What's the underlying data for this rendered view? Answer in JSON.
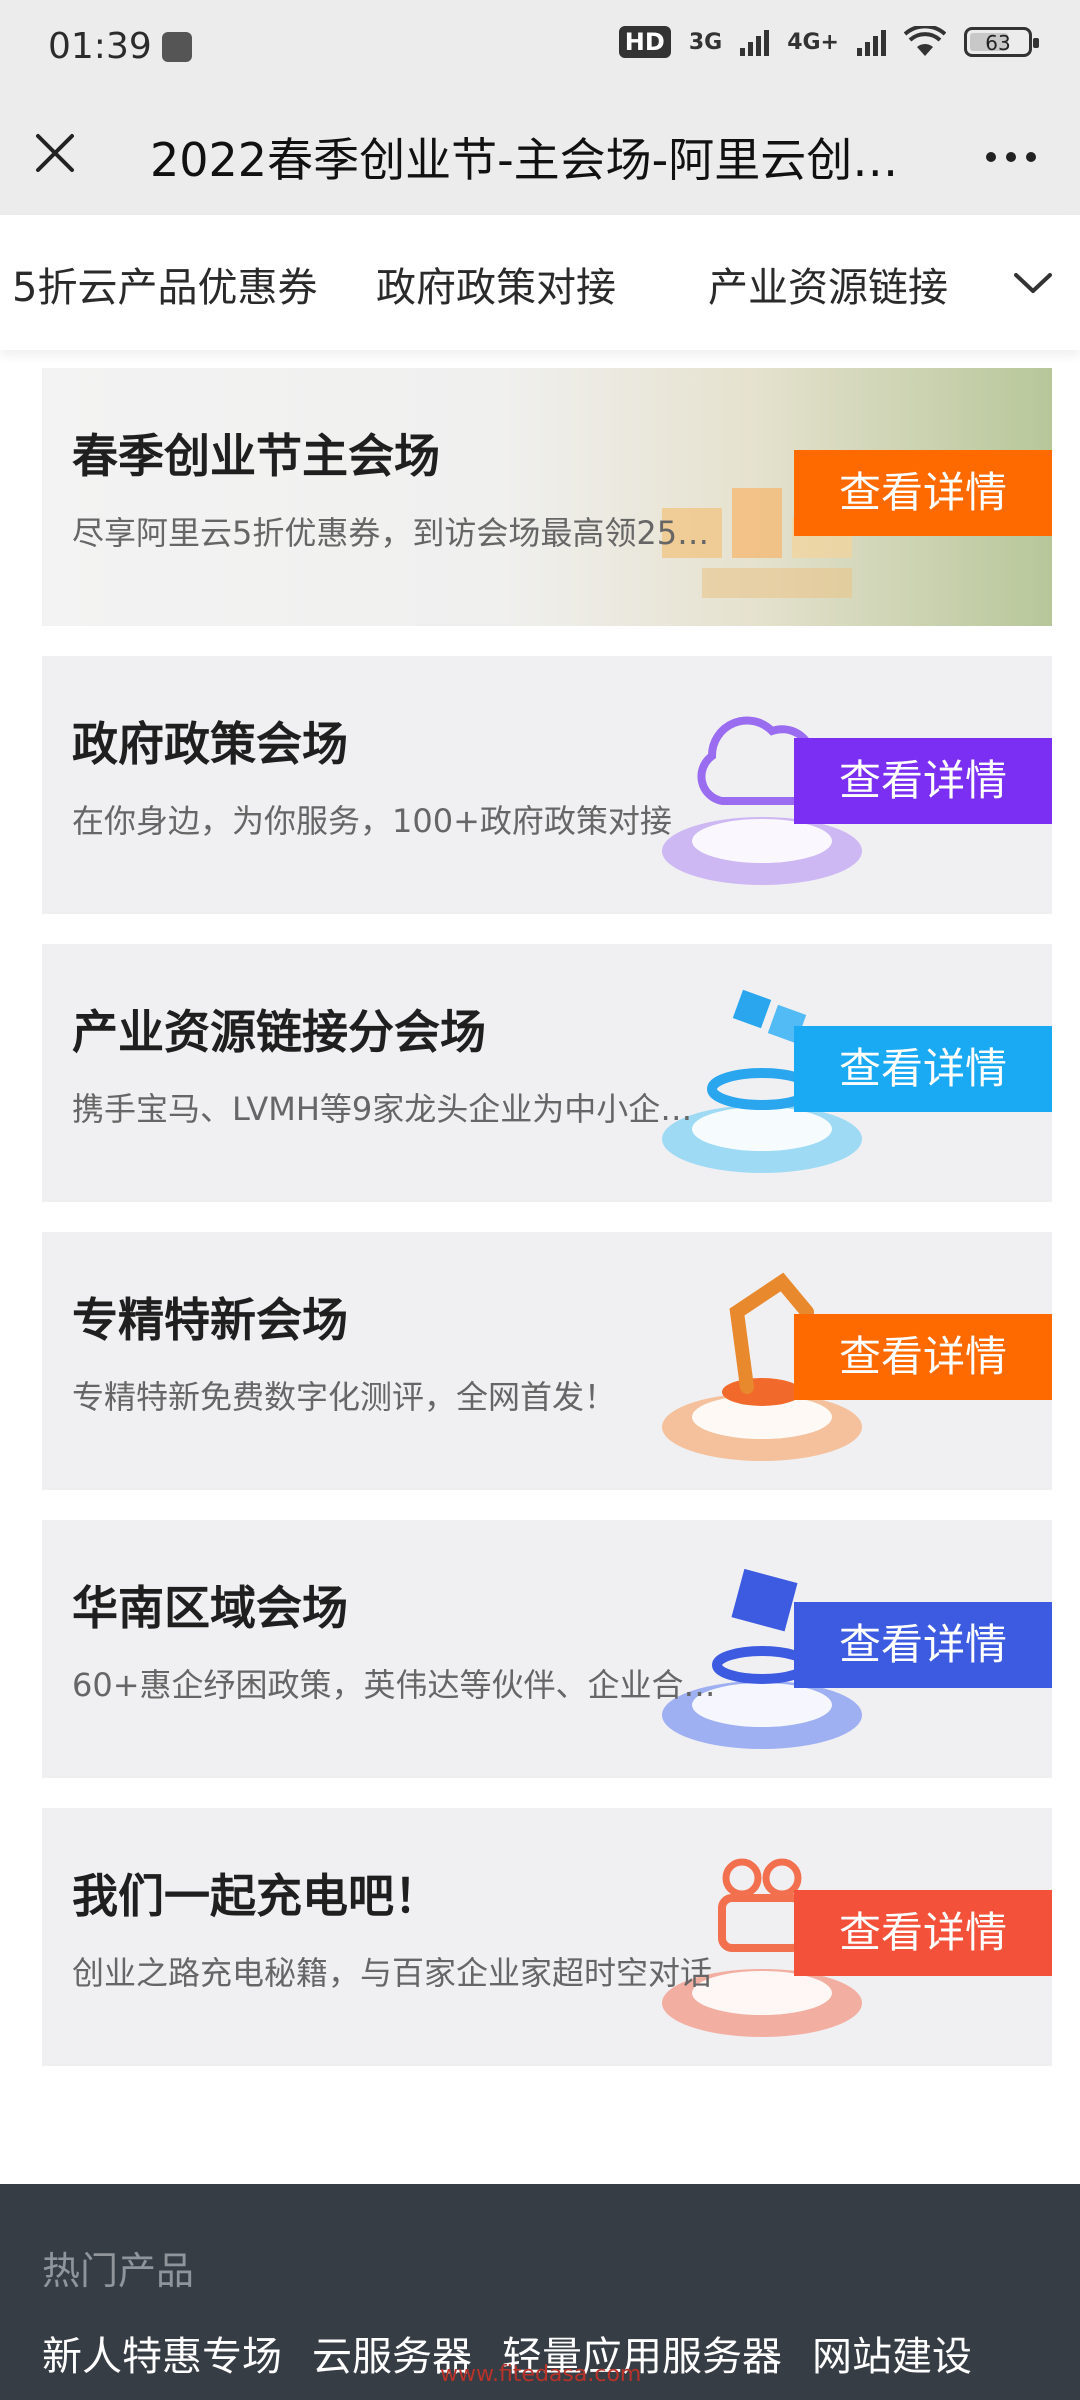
{
  "status_bar": {
    "time": "01:39",
    "hd": "HD",
    "network_3g": "3G",
    "network_4g": "4G+",
    "battery": "63"
  },
  "title_bar": {
    "title": "2022春季创业节-主会场-阿里云创…"
  },
  "tabs": [
    {
      "label": "5折云产品优惠券"
    },
    {
      "label": "政府政策对接"
    },
    {
      "label": "产业资源链接"
    }
  ],
  "cards": [
    {
      "title": "春季创业节主会场",
      "description": "尽享阿里云5折优惠券，到访会场最高领25…",
      "button": "查看详情",
      "button_color": "#ff6a00"
    },
    {
      "title": "政府政策会场",
      "description": "在你身边，为你服务，100+政府政策对接",
      "button": "查看详情",
      "button_color": "#7b2ff2"
    },
    {
      "title": "产业资源链接分会场",
      "description": "携手宝马、LVMH等9家龙头企业为中小企…",
      "button": "查看详情",
      "button_color": "#1aa9f3"
    },
    {
      "title": "专精特新会场",
      "description": "专精特新免费数字化测评，全网首发！",
      "button": "查看详情",
      "button_color": "#ff6a00"
    },
    {
      "title": "华南区域会场",
      "description": "60+惠企纾困政策，英伟达等伙伴、企业合…",
      "button": "查看详情",
      "button_color": "#3d5be0"
    },
    {
      "title": "我们一起充电吧！",
      "description": "创业之路充电秘籍，与百家企业家超时空对话",
      "button": "查看详情",
      "button_color": "#f4513a"
    }
  ],
  "footer": {
    "heading": "热门产品",
    "links": [
      "新人特惠专场",
      "云服务器",
      "轻量应用服务器",
      "网站建设"
    ],
    "watermark": "www.fitedasa.com"
  },
  "colors": {
    "accent_orange": "#ff6a00",
    "accent_purple": "#7b2ff2",
    "accent_blue": "#1aa9f3",
    "accent_indigo": "#3d5be0",
    "accent_red": "#f4513a",
    "footer_bg": "#373d44"
  },
  "icons": {
    "close": "close-icon",
    "more": "more-icon",
    "expand": "chevron-down-icon"
  }
}
